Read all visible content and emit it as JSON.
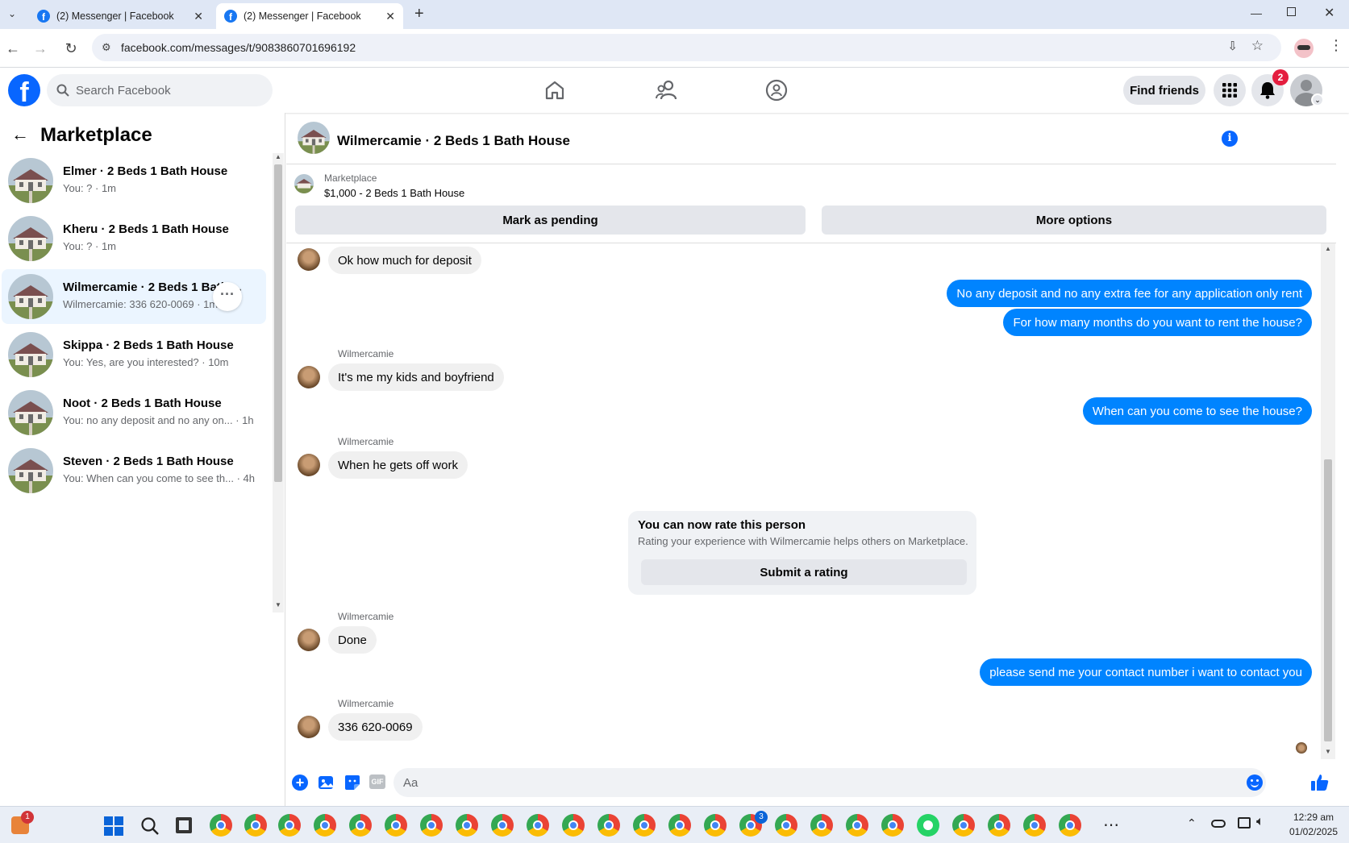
{
  "browser": {
    "tabs": [
      {
        "title": "(2) Messenger | Facebook"
      },
      {
        "title": "(2) Messenger | Facebook"
      }
    ],
    "url": "facebook.com/messages/t/9083860701696192"
  },
  "header": {
    "search_placeholder": "Search Facebook",
    "find_friends": "Find friends",
    "notification_count": "2"
  },
  "sidebar": {
    "title": "Marketplace",
    "conversations": [
      {
        "name": "Elmer · 2 Beds 1 Bath House",
        "preview": "You: ? · 1m"
      },
      {
        "name": "Kheru · 2 Beds 1 Bath House",
        "preview": "You: ? · 1m"
      },
      {
        "name": "Wilmercamie · 2 Beds 1 Bath ...",
        "preview": "Wilmercamie: 336 620-0069 · 1m"
      },
      {
        "name": "Skippa · 2 Beds 1 Bath House",
        "preview": "You: Yes, are you interested? · 10m"
      },
      {
        "name": "Noot · 2 Beds 1 Bath House",
        "preview": "You: no any deposit and no any on... · 1h"
      },
      {
        "name": "Steven · 2 Beds 1 Bath House",
        "preview": "You: When can you come to see th... · 4h"
      }
    ]
  },
  "chat": {
    "title": "Wilmercamie · 2 Beds 1 Bath House",
    "listing_source": "Marketplace",
    "listing_title": "$1,000 - 2 Beds 1 Bath House",
    "mark_pending": "Mark as pending",
    "more_options": "More options",
    "messages": [
      {
        "dir": "in",
        "text": "Ok how much for deposit"
      },
      {
        "dir": "out",
        "text": "No any deposit and no any extra fee for any application only rent"
      },
      {
        "dir": "out",
        "text": "For how many months do you want to rent the house?"
      },
      {
        "dir": "in",
        "sender": "Wilmercamie",
        "text": "It's me my kids and boyfriend"
      },
      {
        "dir": "out",
        "text": "When can you come to see the house?"
      },
      {
        "dir": "in",
        "sender": "Wilmercamie",
        "text": "When he gets off work"
      },
      {
        "dir": "in",
        "sender": "Wilmercamie",
        "text": "Done"
      },
      {
        "dir": "out",
        "text": "please send me your contact number i want to contact you"
      },
      {
        "dir": "in",
        "sender": "Wilmercamie",
        "text": "336 620-0069"
      }
    ],
    "rating": {
      "title": "You can now rate this person",
      "subtitle": "Rating your experience with Wilmercamie helps others on Marketplace.",
      "button": "Submit a rating"
    },
    "composer_placeholder": "Aa"
  },
  "taskbar": {
    "time": "12:29 am",
    "date": "01/02/2025",
    "badge_left": "1",
    "whatsapp_badge": "3"
  },
  "colors": {
    "fb_blue": "#0866ff",
    "outgoing_bubble": "#0084ff",
    "active_conv": "#ebf5ff"
  }
}
